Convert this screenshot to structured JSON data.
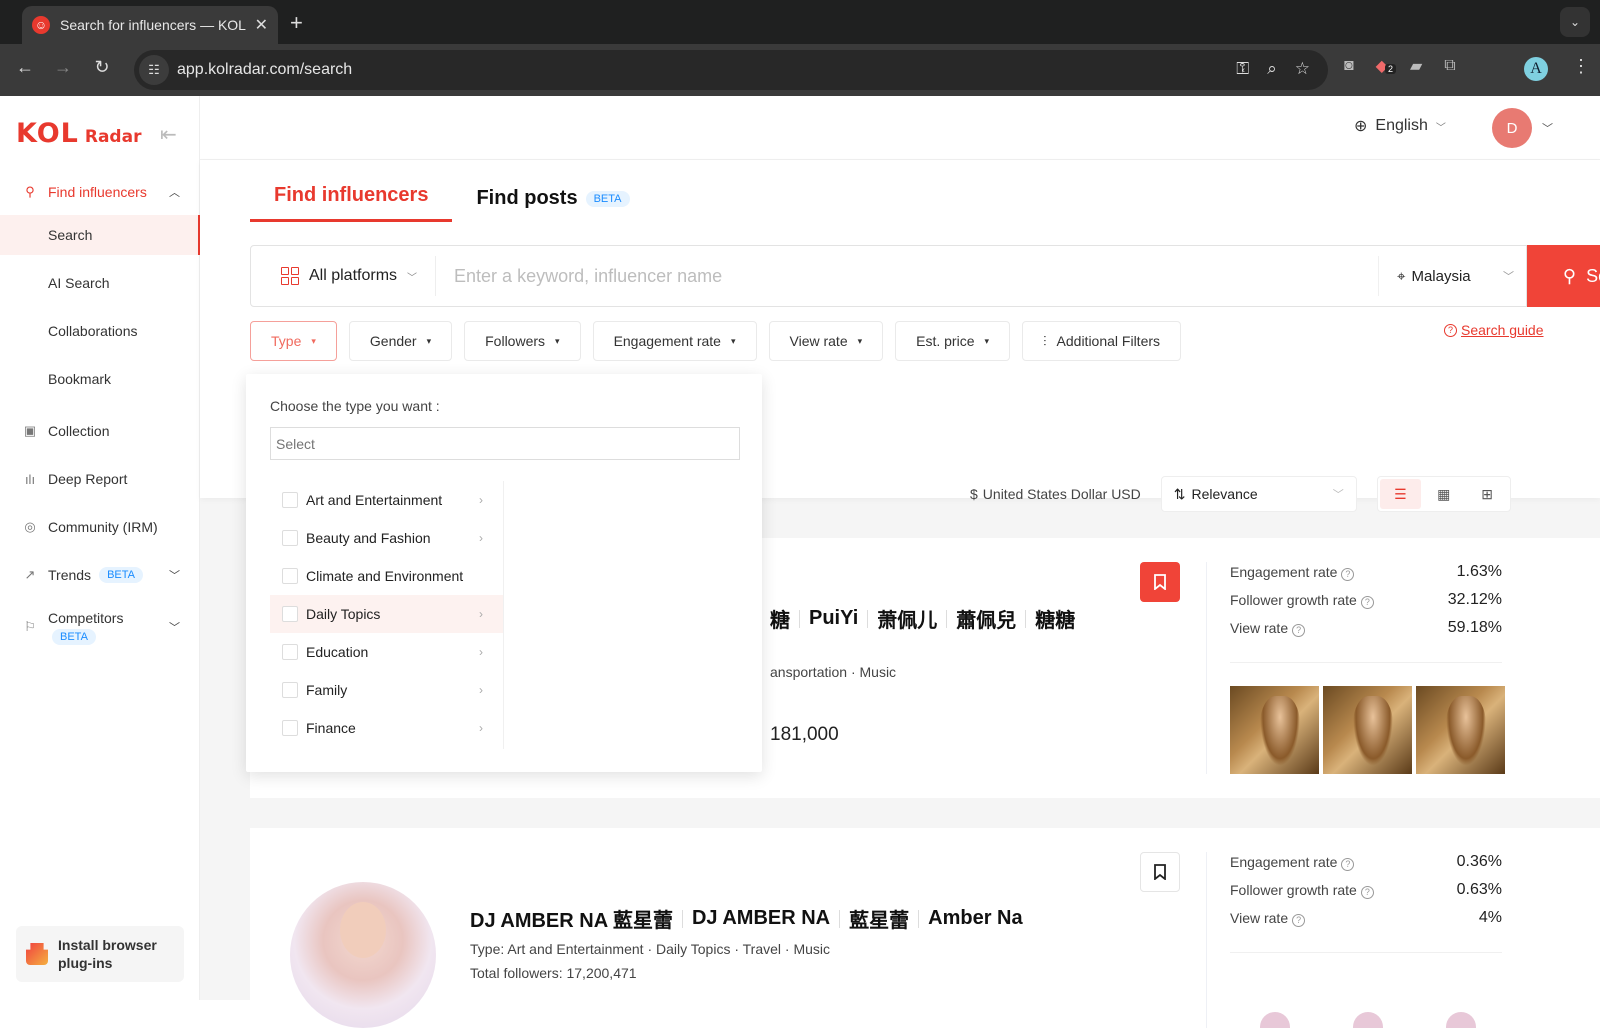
{
  "browser": {
    "tab_title": "Search for influencers — KOL Radar",
    "url": "app.kolradar.com/search",
    "extension_badge": "2",
    "profile_initial": "A"
  },
  "sidebar": {
    "logo_main": "KOL",
    "logo_sub": "Radar",
    "items": [
      {
        "label": "Find influencers",
        "icon": "search-icon",
        "state": "expanded"
      },
      {
        "label": "Search",
        "active": true
      },
      {
        "label": "AI Search"
      },
      {
        "label": "Collaborations"
      },
      {
        "label": "Bookmark"
      },
      {
        "label": "Collection",
        "icon": "collection-icon"
      },
      {
        "label": "Deep Report",
        "icon": "bar-chart-icon"
      },
      {
        "label": "Community (IRM)",
        "icon": "target-icon"
      },
      {
        "label": "Trends",
        "icon": "trend-icon",
        "badge": "BETA"
      },
      {
        "label": "Competitors",
        "icon": "flag-icon",
        "badge": "BETA"
      }
    ],
    "plugin_label": "Install browser plug-ins"
  },
  "header": {
    "language": "English",
    "user_initial": "D"
  },
  "search": {
    "tabs": [
      {
        "label": "Find influencers",
        "active": true
      },
      {
        "label": "Find posts",
        "badge": "BETA"
      }
    ],
    "platform": "All platforms",
    "keyword_placeholder": "Enter a keyword, influencer name",
    "keyword_value": "",
    "country": "Malaysia",
    "search_button": "Search",
    "filters": [
      "Type",
      "Gender",
      "Followers",
      "Engagement rate",
      "View rate",
      "Est. price",
      "Additional Filters"
    ],
    "guide_link": "Search guide"
  },
  "type_dropdown": {
    "title": "Choose the type you want :",
    "select_placeholder": "Select",
    "options": [
      {
        "label": "Art and Entertainment",
        "has_children": true,
        "checked": false
      },
      {
        "label": "Beauty and Fashion",
        "has_children": true,
        "checked": false
      },
      {
        "label": "Climate and Environment",
        "has_children": false,
        "checked": false
      },
      {
        "label": "Daily Topics",
        "has_children": true,
        "checked": false,
        "hovered": true
      },
      {
        "label": "Education",
        "has_children": true,
        "checked": false
      },
      {
        "label": "Family",
        "has_children": true,
        "checked": false
      },
      {
        "label": "Finance",
        "has_children": true,
        "checked": false
      }
    ]
  },
  "results_toolbar": {
    "currency": "United States Dollar USD",
    "sort": "Relevance",
    "views": [
      "list",
      "grid",
      "table"
    ],
    "active_view": "list"
  },
  "results": [
    {
      "names_visible": [
        "糖",
        "PuiYi",
        "萧佩儿",
        "蕭佩兒",
        "糖糖"
      ],
      "type_visible": "ansportation · Music",
      "followers_visible": "181,000",
      "bookmarked": true,
      "stats": [
        {
          "label": "Engagement rate",
          "value": "1.63%"
        },
        {
          "label": "Follower growth rate",
          "value": "32.12%"
        },
        {
          "label": "View rate",
          "value": "59.18%"
        }
      ]
    },
    {
      "names": [
        "DJ AMBER NA 藍星蕾",
        "DJ AMBER NA",
        "藍星蕾",
        "Amber Na"
      ],
      "type_label": "Type:",
      "type": "Art and Entertainment · Daily Topics · Travel · Music",
      "followers_label": "Total followers:",
      "followers": "17,200,471",
      "bookmarked": false,
      "stats": [
        {
          "label": "Engagement rate",
          "value": "0.36%"
        },
        {
          "label": "Follower growth rate",
          "value": "0.63%"
        },
        {
          "label": "View rate",
          "value": "4%"
        }
      ]
    }
  ]
}
